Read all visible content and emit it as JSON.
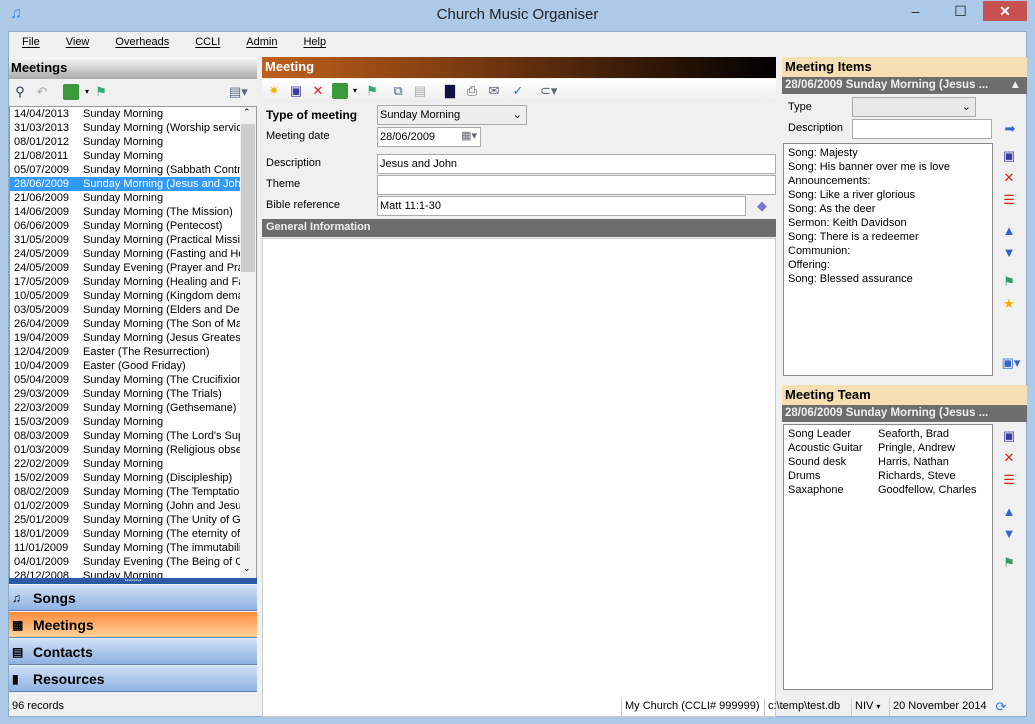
{
  "window": {
    "title": "Church Music Organiser",
    "minimize": "–",
    "maximize": "☐",
    "close": "✕"
  },
  "menu": [
    "File",
    "View",
    "Overheads",
    "CCLI",
    "Admin",
    "Help"
  ],
  "meetings_panel": {
    "title": "Meetings",
    "items": [
      {
        "date": "14/04/2013",
        "name": "Sunday Morning"
      },
      {
        "date": "31/03/2013",
        "name": "Sunday Morning (Worship service"
      },
      {
        "date": "08/01/2012",
        "name": "Sunday Morning"
      },
      {
        "date": "21/08/2011",
        "name": "Sunday Morning"
      },
      {
        "date": "05/07/2009",
        "name": "Sunday Morning (Sabbath Contr"
      },
      {
        "date": "28/06/2009",
        "name": "Sunday Morning (Jesus and John",
        "selected": true
      },
      {
        "date": "21/06/2009",
        "name": "Sunday Morning"
      },
      {
        "date": "14/06/2009",
        "name": "Sunday Morning (The Mission)"
      },
      {
        "date": "06/06/2009",
        "name": "Sunday Morning (Pentecost)"
      },
      {
        "date": "31/05/2009",
        "name": "Sunday Morning (Practical Missio"
      },
      {
        "date": "24/05/2009",
        "name": "Sunday Morning (Fasting and He"
      },
      {
        "date": "24/05/2009",
        "name": "Sunday Evening (Prayer and Pra"
      },
      {
        "date": "17/05/2009",
        "name": "Sunday Morning (Healing and Fa"
      },
      {
        "date": "10/05/2009",
        "name": "Sunday Morning (Kingdom demar"
      },
      {
        "date": "03/05/2009",
        "name": "Sunday Morning (Elders and Dea"
      },
      {
        "date": "26/04/2009",
        "name": "Sunday Morning (The Son of Mar"
      },
      {
        "date": "19/04/2009",
        "name": "Sunday Morning (Jesus Greatest"
      },
      {
        "date": "12/04/2009",
        "name": "Easter (The Resurrection)"
      },
      {
        "date": "10/04/2009",
        "name": "Easter (Good Friday)"
      },
      {
        "date": "05/04/2009",
        "name": "Sunday Morning (The Crucifixion"
      },
      {
        "date": "29/03/2009",
        "name": "Sunday Morning (The Trials)"
      },
      {
        "date": "22/03/2009",
        "name": "Sunday Morning (Gethsemane)"
      },
      {
        "date": "15/03/2009",
        "name": "Sunday Morning"
      },
      {
        "date": "08/03/2009",
        "name": "Sunday Morning (The Lord's Sup"
      },
      {
        "date": "01/03/2009",
        "name": "Sunday Morning (Religious obser"
      },
      {
        "date": "22/02/2009",
        "name": "Sunday Morning"
      },
      {
        "date": "15/02/2009",
        "name": "Sunday Morning (Discipleship)"
      },
      {
        "date": "08/02/2009",
        "name": "Sunday Morning (The Temptation"
      },
      {
        "date": "01/02/2009",
        "name": "Sunday Morning (John and Jesus"
      },
      {
        "date": "25/01/2009",
        "name": "Sunday Morning (The Unity of G"
      },
      {
        "date": "18/01/2009",
        "name": "Sunday Morning (The eternity of"
      },
      {
        "date": "11/01/2009",
        "name": "Sunday Morning (The immutabilit"
      },
      {
        "date": "04/01/2009",
        "name": "Sunday Evening (The Being of G"
      },
      {
        "date": "28/12/2008",
        "name": "Sunday Morning"
      }
    ]
  },
  "nav": [
    {
      "label": "Songs",
      "icon": "♫"
    },
    {
      "label": "Meetings",
      "icon": "▦",
      "active": true
    },
    {
      "label": "Contacts",
      "icon": "▤"
    },
    {
      "label": "Resources",
      "icon": "▮"
    }
  ],
  "meeting": {
    "title": "Meeting",
    "type_label": "Type of meeting",
    "type_value": "Sunday Morning",
    "date_label": "Meeting date",
    "date_value": "28/06/2009",
    "description_label": "Description",
    "description_value": "Jesus and John",
    "theme_label": "Theme",
    "theme_value": "",
    "bible_label": "Bible reference",
    "bible_value": "Matt 11:1-30",
    "general_info": "General Information"
  },
  "meeting_items": {
    "title": "Meeting Items",
    "subtitle": "28/06/2009 Sunday Morning (Jesus ...",
    "type_label": "Type",
    "type_value": "",
    "description_label": "Description",
    "description_value": "",
    "items": [
      "Song: Majesty",
      "Song: His banner over me is love",
      "Announcements:",
      "Song: Like a river glorious",
      "Song: As the deer",
      "Sermon: Keith Davidson",
      "Song: There is a redeemer",
      "Communion:",
      "Offering:",
      "Song: Blessed assurance"
    ]
  },
  "meeting_team": {
    "title": "Meeting Team",
    "subtitle": "28/06/2009 Sunday Morning (Jesus ...",
    "members": [
      {
        "role": "Song Leader",
        "name": "Seaforth, Brad"
      },
      {
        "role": "Acoustic Guitar",
        "name": "Pringle, Andrew"
      },
      {
        "role": "Sound desk",
        "name": "Harris, Nathan"
      },
      {
        "role": "Drums",
        "name": "Richards, Steve"
      },
      {
        "role": "Saxaphone",
        "name": "Goodfellow, Charles"
      }
    ]
  },
  "status": {
    "records": "96 records",
    "church": "My Church (CCLI# 999999)",
    "db": "c:\\temp\\test.db",
    "bible": "NIV",
    "date": "20 November 2014"
  }
}
